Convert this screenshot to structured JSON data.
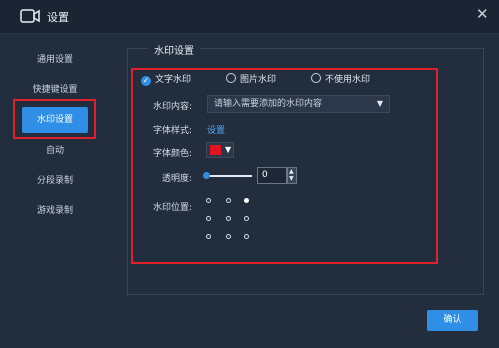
{
  "window": {
    "title": "设置"
  },
  "sidebar": {
    "items": [
      {
        "label": "通用设置"
      },
      {
        "label": "快捷键设置"
      },
      {
        "label": "水印设置"
      },
      {
        "label": "自动"
      },
      {
        "label": "分段录制"
      },
      {
        "label": "游戏录制"
      }
    ],
    "active_index": 2
  },
  "panel": {
    "title": "水印设置",
    "watermark_type": {
      "options": [
        {
          "label": "文字水印",
          "selected": true
        },
        {
          "label": "图片水印",
          "selected": false
        },
        {
          "label": "不使用水印",
          "selected": false
        }
      ]
    },
    "content": {
      "label": "水印内容:",
      "placeholder": "请输入需要添加的水印内容"
    },
    "font_style": {
      "label": "字体样式:",
      "link": "设置"
    },
    "font_color": {
      "label": "字体颜色:",
      "value": "#e0141e"
    },
    "opacity": {
      "label": "透明度:",
      "value": "0"
    },
    "position": {
      "label": "水印位置:",
      "selected_index": 2
    }
  },
  "footer": {
    "confirm_label": "确认"
  },
  "colors": {
    "accent": "#2f8fe6",
    "highlight_red": "#e0202a",
    "background": "#222d3d"
  }
}
